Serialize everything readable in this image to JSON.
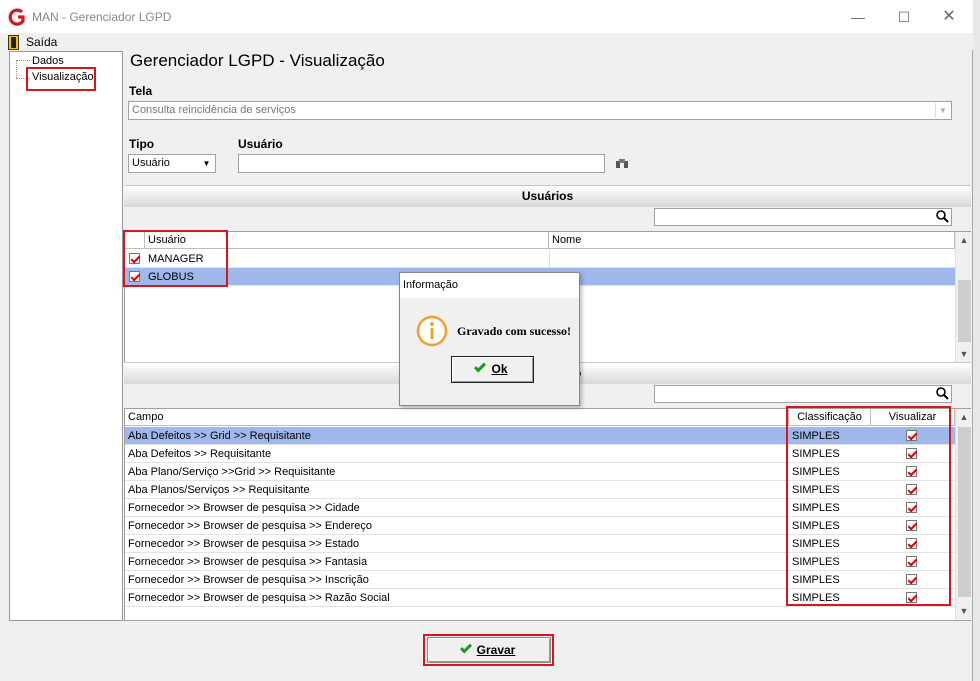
{
  "window": {
    "title": "MAN - Gerenciador LGPD",
    "menu_exit": "Saída"
  },
  "tree": {
    "items": [
      "Dados",
      "Visualização"
    ]
  },
  "page": {
    "title": "Gerenciador LGPD - Visualização"
  },
  "form": {
    "tela_label": "Tela",
    "tela_value": "Consulta reincidência de serviços",
    "tipo_label": "Tipo",
    "tipo_value": "Usuário",
    "usuario_label": "Usuário",
    "usuario_value": ""
  },
  "users_section": {
    "title": "Usuários",
    "search_value": "",
    "columns": [
      "Usuário",
      "Nome"
    ],
    "rows": [
      {
        "usuario": "MANAGER",
        "nome": "",
        "checked": true,
        "selected": false
      },
      {
        "usuario": "GLOBUS",
        "nome": "",
        "checked": true,
        "selected": true
      }
    ]
  },
  "fields_section": {
    "title_fragment": "o",
    "search_value": "",
    "columns": [
      "Campo",
      "Classificação",
      "Visualizar"
    ],
    "rows": [
      {
        "campo": "Aba Defeitos >> Grid >> Requisitante",
        "classificacao": "SIMPLES",
        "visualizar": true,
        "selected": true
      },
      {
        "campo": "Aba Defeitos >> Requisitante",
        "classificacao": "SIMPLES",
        "visualizar": true,
        "selected": false
      },
      {
        "campo": "Aba Plano/Serviço >>Grid >> Requisitante",
        "classificacao": "SIMPLES",
        "visualizar": true,
        "selected": false
      },
      {
        "campo": "Aba Planos/Serviços >> Requisitante",
        "classificacao": "SIMPLES",
        "visualizar": true,
        "selected": false
      },
      {
        "campo": "Fornecedor >> Browser de pesquisa >> Cidade",
        "classificacao": "SIMPLES",
        "visualizar": true,
        "selected": false
      },
      {
        "campo": "Fornecedor >> Browser de pesquisa >> Endereço",
        "classificacao": "SIMPLES",
        "visualizar": true,
        "selected": false
      },
      {
        "campo": "Fornecedor >> Browser de pesquisa >> Estado",
        "classificacao": "SIMPLES",
        "visualizar": true,
        "selected": false
      },
      {
        "campo": "Fornecedor >> Browser de pesquisa >> Fantasia",
        "classificacao": "SIMPLES",
        "visualizar": true,
        "selected": false
      },
      {
        "campo": "Fornecedor >> Browser de pesquisa >> Inscrição",
        "classificacao": "SIMPLES",
        "visualizar": true,
        "selected": false
      },
      {
        "campo": "Fornecedor >> Browser de pesquisa >> Razão Social",
        "classificacao": "SIMPLES",
        "visualizar": true,
        "selected": false
      }
    ]
  },
  "dialog": {
    "title": "Informação",
    "message": "Gravado com sucesso!",
    "ok_label": "Ok"
  },
  "footer": {
    "save_label": "Gravar"
  },
  "colors": {
    "highlight_red": "#d8141c",
    "selection_blue": "#9fb8eb",
    "info_orange": "#f0a030",
    "check_green": "#1a9a1a"
  }
}
